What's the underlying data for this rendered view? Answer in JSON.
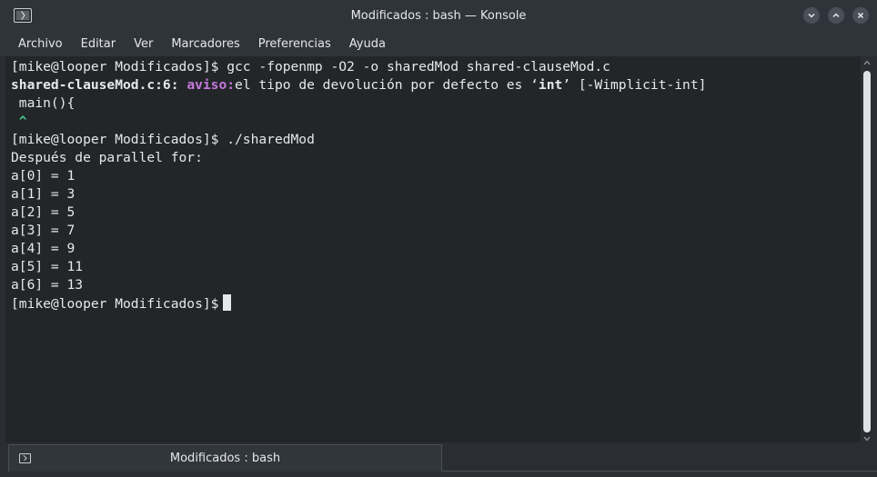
{
  "window": {
    "title": "Modificados : bash — Konsole"
  },
  "menu": {
    "items": [
      "Archivo",
      "Editar",
      "Ver",
      "Marcadores",
      "Preferencias",
      "Ayuda"
    ]
  },
  "terminal": {
    "line1": "[mike@looper Modificados]$ gcc -fopenmp -O2 -o sharedMod shared-clauseMod.c",
    "line2_file": "shared-clauseMod.c:6:",
    "line2_tag": "aviso:",
    "line2_msg_a": "el tipo de devolución por defecto es ‘",
    "line2_kw": "int",
    "line2_msg_b": "’ [-Wimplicit-int]",
    "line3": " main(){",
    "line4": " ^",
    "line5": "[mike@looper Modificados]$ ./sharedMod",
    "line6": "Después de parallel for:",
    "line7": "a[0] = 1",
    "line8": "a[1] = 3",
    "line9": "a[2] = 5",
    "line10": "a[3] = 7",
    "line11": "a[4] = 9",
    "line12": "a[5] = 11",
    "line13": "a[6] = 13",
    "prompt": "[mike@looper Modificados]$"
  },
  "tabs": {
    "active_label": "Modificados : bash"
  },
  "colors": {
    "warning": "#c678dd",
    "caret": "#3fc68a",
    "background": "#232629"
  }
}
